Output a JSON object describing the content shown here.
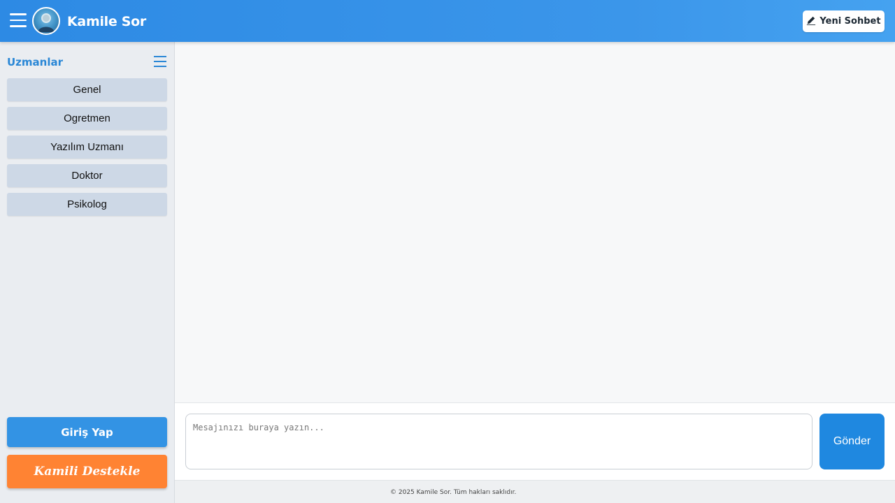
{
  "header": {
    "brand": "Kamile Sor",
    "new_chat_label": "Yeni Sohbet",
    "icons": [
      "hamburger-menu-icon",
      "avatar",
      "pencil-icon"
    ]
  },
  "sidebar": {
    "title": "Uzmanlar",
    "experts": [
      {
        "label": "Genel"
      },
      {
        "label": "Ogretmen"
      },
      {
        "label": "Yazılım Uzmanı"
      },
      {
        "label": "Doktor"
      },
      {
        "label": "Psikolog"
      }
    ],
    "login_label": "Giriş Yap",
    "support_label": "Kamili Destekle"
  },
  "composer": {
    "placeholder": "Mesajınızı buraya yazın...",
    "value": "",
    "send_label": "Gönder"
  },
  "footer": {
    "text": "© 2025 Kamile Sor. Tüm hakları saklıdır."
  },
  "colors": {
    "header": "#2d8ae4",
    "accent": "#2a87d6",
    "expert_button": "#cdd8e6",
    "login": "#3393e4",
    "support": "#ff8333",
    "send": "#1f88e0"
  }
}
